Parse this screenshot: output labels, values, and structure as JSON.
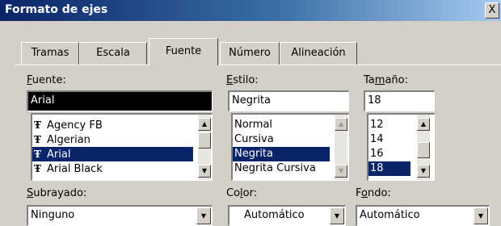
{
  "window": {
    "title": "Formato de ejes",
    "close_glyph": "X"
  },
  "tabs": [
    {
      "label": "Tramas",
      "active": false
    },
    {
      "label": "Escala",
      "active": false
    },
    {
      "label": "Fuente",
      "active": true
    },
    {
      "label": "Número",
      "active": false
    },
    {
      "label": "Alineación",
      "active": false
    }
  ],
  "font": {
    "label_first": "F",
    "label_rest": "uente:",
    "value": "Arial",
    "items": [
      "Agency FB",
      "Algerian",
      "Arial",
      "Arial Black"
    ],
    "selected_index": 2
  },
  "style": {
    "label_first": "E",
    "label_rest": "stilo:",
    "value": "Negrita",
    "items": [
      "Normal",
      "Cursiva",
      "Negrita",
      "Negrita Cursiva"
    ],
    "selected_index": 2
  },
  "size": {
    "label_pre": "Ta",
    "label_key": "m",
    "label_rest": "año:",
    "value": "18",
    "items": [
      "12",
      "14",
      "16",
      "18"
    ],
    "selected_index": 3
  },
  "underline": {
    "label_first": "S",
    "label_rest": "ubrayado:",
    "value": "Ninguno"
  },
  "color": {
    "label_pre": "Co",
    "label_key": "l",
    "label_rest": "or:",
    "value": "Automático"
  },
  "background": {
    "label_pre": "F",
    "label_key": "o",
    "label_rest": "ndo:",
    "value": "Automático"
  },
  "icons": {
    "font_type": "truetype-font-icon",
    "scroll_up": "arrow-up-icon",
    "scroll_down": "arrow-down-icon",
    "dropdown": "chevron-down-icon"
  },
  "colors": {
    "title_bar": "#0a246a",
    "selection": "#0a246a",
    "dialog_bg": "#d4d0c8"
  }
}
